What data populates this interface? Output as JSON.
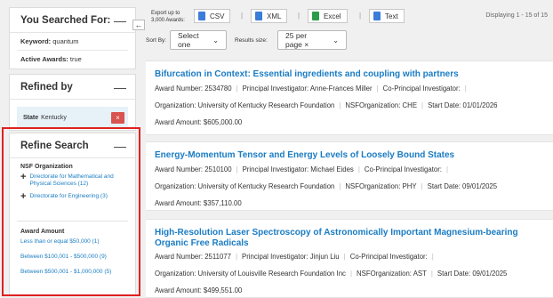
{
  "sidebar": {
    "searched": {
      "title": "You Searched For:",
      "keyword_label": "Keyword:",
      "keyword_value": "quantum",
      "active_label": "Active Awards:",
      "active_value": "true"
    },
    "refined": {
      "title": "Refined by",
      "chip_label": "State",
      "chip_value": "Kentucky",
      "chip_remove": "×"
    },
    "refine": {
      "title": "Refine Search",
      "org_label": "NSF Organization",
      "orgs": [
        "Directorate for Mathematical and Physical Sciences (12)",
        "Directorate for Engineering (3)"
      ],
      "amount_label": "Award Amount",
      "amounts": [
        "Less than or equal $50,000 (1)",
        "Between $100,001 - $500,000 (9)",
        "Between $500,001 - $1,000,000 (5)"
      ]
    },
    "collapse_icon": "←",
    "minus_icon": "—"
  },
  "toolbar": {
    "export_label": "Export up to 3,000 Awards:",
    "formats": [
      "CSV",
      "XML",
      "Excel",
      "Text"
    ],
    "format_colors": [
      "#3b7dd8",
      "#3b7dd8",
      "#2e9b4a",
      "#3b7dd8"
    ],
    "pipe": "|",
    "display_count": "Displaying 1 - 15 of 15"
  },
  "sort": {
    "label": "Sort By:",
    "value": "Select one",
    "results_label": "Results size:",
    "results_value": "25 per page ×",
    "chevron": "⌄"
  },
  "awards": [
    {
      "title": "Bifurcation in Context: Essential ingredients and coupling with partners",
      "award_number": "Award Number: 2534780",
      "pi": "Principal Investigator: Anne-Frances Miller",
      "copi": "Co-Principal Investigator:",
      "org": "Organization: University of Kentucky Research Foundation",
      "nsf_org": "NSFOrganization: CHE",
      "start": "Start Date: 01/01/2026",
      "amount": "Award Amount: $605,000.00"
    },
    {
      "title": "Energy-Momentum Tensor and Energy Levels of Loosely Bound States",
      "award_number": "Award Number: 2510100",
      "pi": "Principal Investigator: Michael Eides",
      "copi": "Co-Principal Investigator:",
      "org": "Organization: University of Kentucky Research Foundation",
      "nsf_org": "NSFOrganization: PHY",
      "start": "Start Date: 09/01/2025",
      "amount": "Award Amount: $357,110.00"
    },
    {
      "title": "High-Resolution Laser Spectroscopy of Astronomically Important Magnesium-bearing Organic Free Radicals",
      "award_number": "Award Number: 2511077",
      "pi": "Principal Investigator: Jinjun Liu",
      "copi": "Co-Principal Investigator:",
      "org": "Organization: University of Louisville Research Foundation Inc",
      "nsf_org": "NSFOrganization: AST",
      "start": "Start Date: 09/01/2025",
      "amount": "Award Amount: $499,551.00"
    }
  ]
}
